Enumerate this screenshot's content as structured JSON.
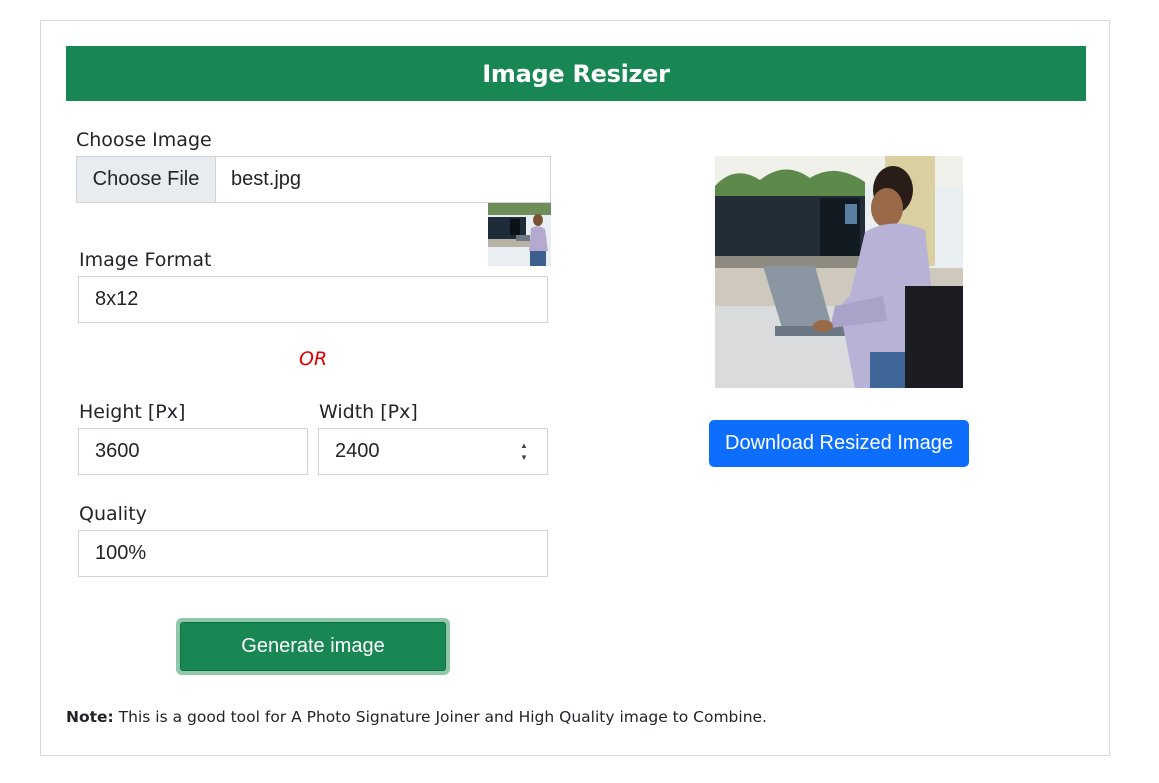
{
  "header": {
    "title": "Image Resizer"
  },
  "choose_image": {
    "label": "Choose Image",
    "button_label": "Choose File",
    "file_name": "best.jpg"
  },
  "image_format": {
    "label": "Image Format",
    "value": "8x12"
  },
  "or_text": "OR",
  "height": {
    "label": "Height [Px]",
    "value": "3600"
  },
  "width": {
    "label": "Width [Px]",
    "value": "2400"
  },
  "quality": {
    "label": "Quality",
    "value": "100%"
  },
  "generate_button": "Generate image",
  "download_button": "Download Resized Image",
  "note": {
    "prefix": "Note:",
    "text": " This is a good tool for A Photo Signature Joiner and High Quality image to Combine."
  },
  "colors": {
    "header_bg": "#198754",
    "generate_bg": "#198754",
    "download_bg": "#0d6efd",
    "or_color": "#e00000"
  }
}
